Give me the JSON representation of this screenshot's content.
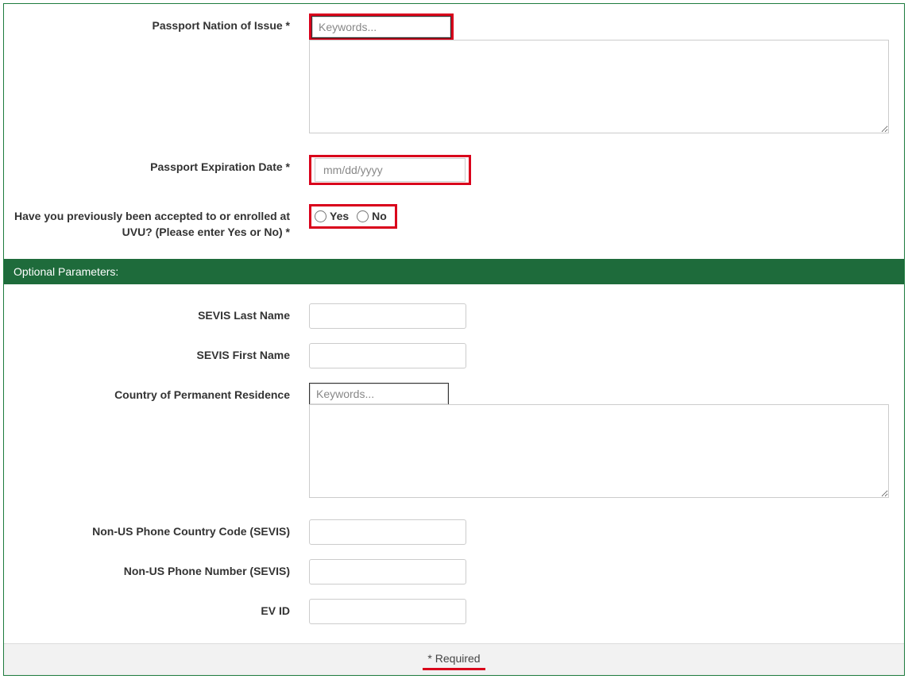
{
  "fields": {
    "passport_nation": {
      "label": "Passport Nation of Issue *",
      "placeholder": "Keywords..."
    },
    "passport_expiration": {
      "label": "Passport Expiration Date *",
      "placeholder": "mm/dd/yyyy"
    },
    "previously_accepted": {
      "label": "Have you previously been accepted to or enrolled at UVU? (Please enter Yes or No) *",
      "options": {
        "yes": "Yes",
        "no": "No"
      }
    }
  },
  "section_header": "Optional Parameters:",
  "optional_fields": {
    "sevis_last_name": {
      "label": "SEVIS Last Name"
    },
    "sevis_first_name": {
      "label": "SEVIS First Name"
    },
    "country_residence": {
      "label": "Country of Permanent Residence",
      "placeholder": "Keywords..."
    },
    "non_us_phone_code": {
      "label": "Non-US Phone Country Code (SEVIS)"
    },
    "non_us_phone_number": {
      "label": "Non-US Phone Number (SEVIS)"
    },
    "ev_id": {
      "label": "EV ID"
    }
  },
  "footer": {
    "required_text": "* Required"
  }
}
